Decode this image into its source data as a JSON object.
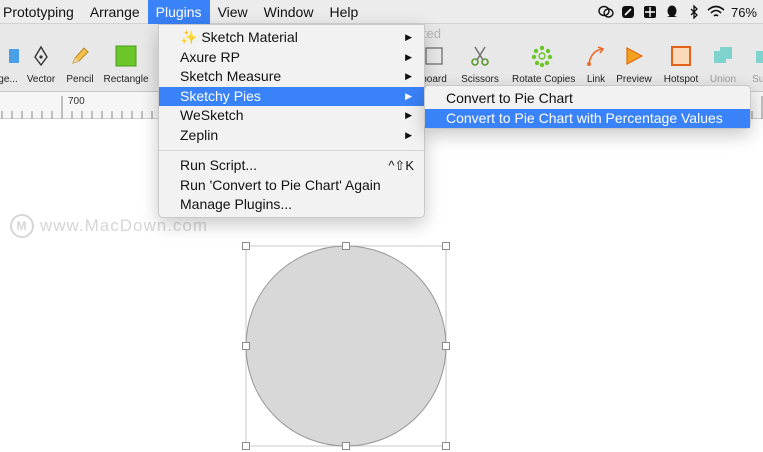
{
  "menubar": {
    "items": [
      "Prototyping",
      "Arrange",
      "Plugins",
      "View",
      "Window",
      "Help"
    ],
    "active_index": 2,
    "battery": "76%"
  },
  "toolbar": {
    "document_title": "ited",
    "tools": [
      {
        "label": "ge...",
        "icon": "shape-icon"
      },
      {
        "label": "Vector",
        "icon": "pen-icon"
      },
      {
        "label": "Pencil",
        "icon": "pencil-icon"
      },
      {
        "label": "Rectangle",
        "icon": "rectangle-icon"
      },
      {
        "label": "board",
        "icon": "artboard-icon"
      },
      {
        "label": "Scissors",
        "icon": "scissors-icon"
      },
      {
        "label": "Rotate Copies",
        "icon": "rotate-copies-icon"
      },
      {
        "label": "Link",
        "icon": "link-icon"
      },
      {
        "label": "Preview",
        "icon": "preview-icon"
      },
      {
        "label": "Hotspot",
        "icon": "hotspot-icon"
      },
      {
        "label": "Union",
        "icon": "union-icon"
      },
      {
        "label": "Sub",
        "icon": "subtract-icon"
      }
    ]
  },
  "ruler": {
    "label": "700"
  },
  "watermark": {
    "text": "www.MacDown.com"
  },
  "plugins_menu": {
    "group1": [
      {
        "label": "✨ Sketch Material",
        "has_submenu": true
      },
      {
        "label": "Axure RP",
        "has_submenu": true
      },
      {
        "label": "Sketch Measure",
        "has_submenu": true
      },
      {
        "label": "Sketchy Pies",
        "has_submenu": true,
        "selected": true
      },
      {
        "label": "WeSketch",
        "has_submenu": true
      },
      {
        "label": "Zeplin",
        "has_submenu": true
      }
    ],
    "group2": [
      {
        "label": "Run Script...",
        "shortcut": "^⇧K"
      },
      {
        "label": "Run 'Convert to Pie Chart' Again"
      },
      {
        "label": "Manage Plugins..."
      }
    ]
  },
  "submenu": {
    "items": [
      {
        "label": "Convert to Pie Chart"
      },
      {
        "label": "Convert to Pie Chart with Percentage Values",
        "selected": true
      }
    ]
  },
  "colors": {
    "accent": "#3a82f7",
    "circle_fill": "#d8d8d8",
    "circle_stroke": "#979797"
  }
}
